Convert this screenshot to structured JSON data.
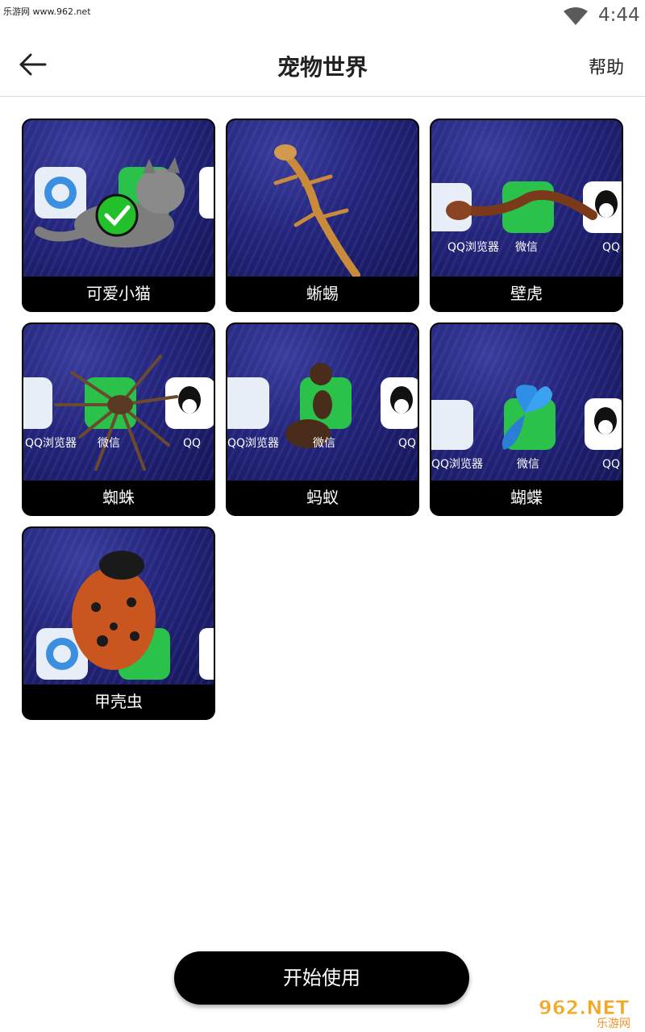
{
  "status_bar": {
    "watermark": "乐游网 www.962.net",
    "time": "4:44",
    "wifi_icon": "wifi-icon"
  },
  "header": {
    "back_icon": "arrow-left-icon",
    "title": "宠物世界",
    "help_label": "帮助"
  },
  "pets": [
    {
      "name": "可爱小猫",
      "selected": true,
      "icon": "cat"
    },
    {
      "name": "蜥蜴",
      "selected": false,
      "icon": "lizard"
    },
    {
      "name": "壁虎",
      "selected": false,
      "icon": "gecko"
    },
    {
      "name": "蜘蛛",
      "selected": false,
      "icon": "spider"
    },
    {
      "name": "蚂蚁",
      "selected": false,
      "icon": "ant"
    },
    {
      "name": "蝴蝶",
      "selected": false,
      "icon": "butterfly"
    },
    {
      "name": "甲壳虫",
      "selected": false,
      "icon": "ladybug"
    }
  ],
  "app_icon_labels": {
    "browser": "QQ浏览器",
    "wechat": "微信",
    "qq": "QQ"
  },
  "start_button_label": "开始使用",
  "bottom_watermark": {
    "brand": "962.NET",
    "sub": "乐游网"
  },
  "colors": {
    "accent": "#000000",
    "check": "#2ecc2e",
    "card_bg": "#24257a"
  }
}
